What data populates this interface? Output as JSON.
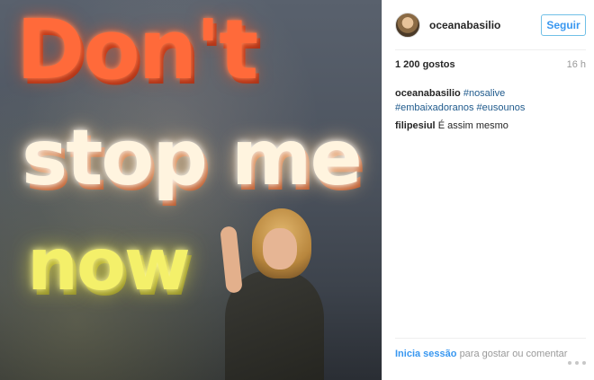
{
  "photo": {
    "sign_lines": [
      "Don't",
      "stop me",
      "now"
    ]
  },
  "header": {
    "username": "oceanabasilio",
    "follow_label": "Seguir"
  },
  "stats": {
    "likes": "1 200 gostos",
    "time": "16 h"
  },
  "caption": {
    "user": "oceanabasilio",
    "hashtags": [
      "#nosalive",
      "#embaixadoranos",
      "#eusounos"
    ]
  },
  "comments": [
    {
      "user": "filipesiul",
      "text": "É assim mesmo"
    }
  ],
  "footer": {
    "login_link": "Inicia sessão",
    "login_text": "para gostar ou comentar"
  },
  "icons": {
    "more": "more-options-icon"
  },
  "colors": {
    "link_blue": "#3897f0",
    "hashtag": "#1f5a8c",
    "muted": "#999999"
  }
}
